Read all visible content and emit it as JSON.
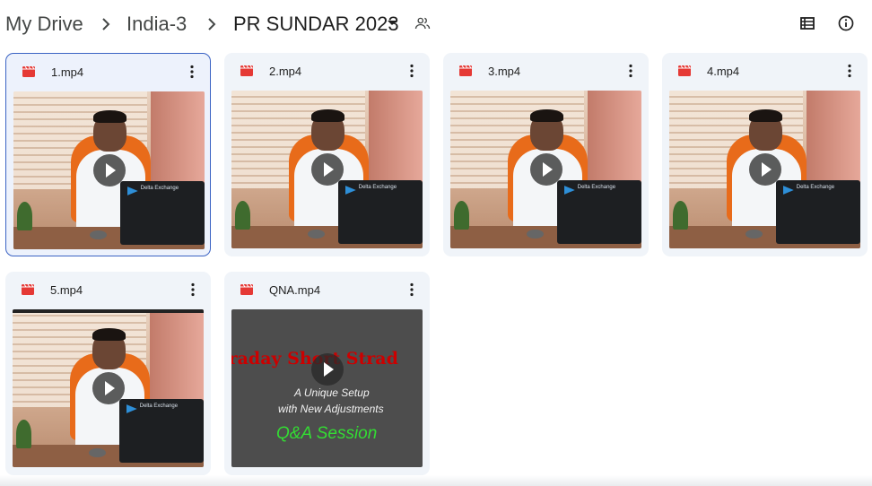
{
  "breadcrumb": {
    "root": "My Drive",
    "parent": "India-3",
    "current": "PR SUNDAR 2023"
  },
  "toolbar": {
    "share_icon": "shared-folder-icon",
    "view_icon": "list-view-icon",
    "info_icon": "info-icon"
  },
  "files": [
    {
      "name": "1.mp4",
      "icon": "video-file-icon",
      "selected": true
    },
    {
      "name": "2.mp4",
      "icon": "video-file-icon",
      "selected": false
    },
    {
      "name": "3.mp4",
      "icon": "video-file-icon",
      "selected": false
    },
    {
      "name": "4.mp4",
      "icon": "video-file-icon",
      "selected": false
    },
    {
      "name": "5.mp4",
      "icon": "video-file-icon",
      "selected": false
    },
    {
      "name": "QNA.mp4",
      "icon": "video-file-icon",
      "selected": false
    }
  ],
  "thumbnail_overlay": {
    "laptop_brand": "Delta Exchange"
  },
  "qna_thumbnail": {
    "title": "ntraday Short Strad",
    "line1": "A Unique Setup",
    "line2": "with New Adjustments",
    "line3": "Q&A Session"
  },
  "colors": {
    "accent": "#3b63c4",
    "card_bg": "#f0f4f9",
    "video_icon": "#e53935",
    "qna_title": "#cc0000",
    "qna_session": "#33dd33"
  }
}
